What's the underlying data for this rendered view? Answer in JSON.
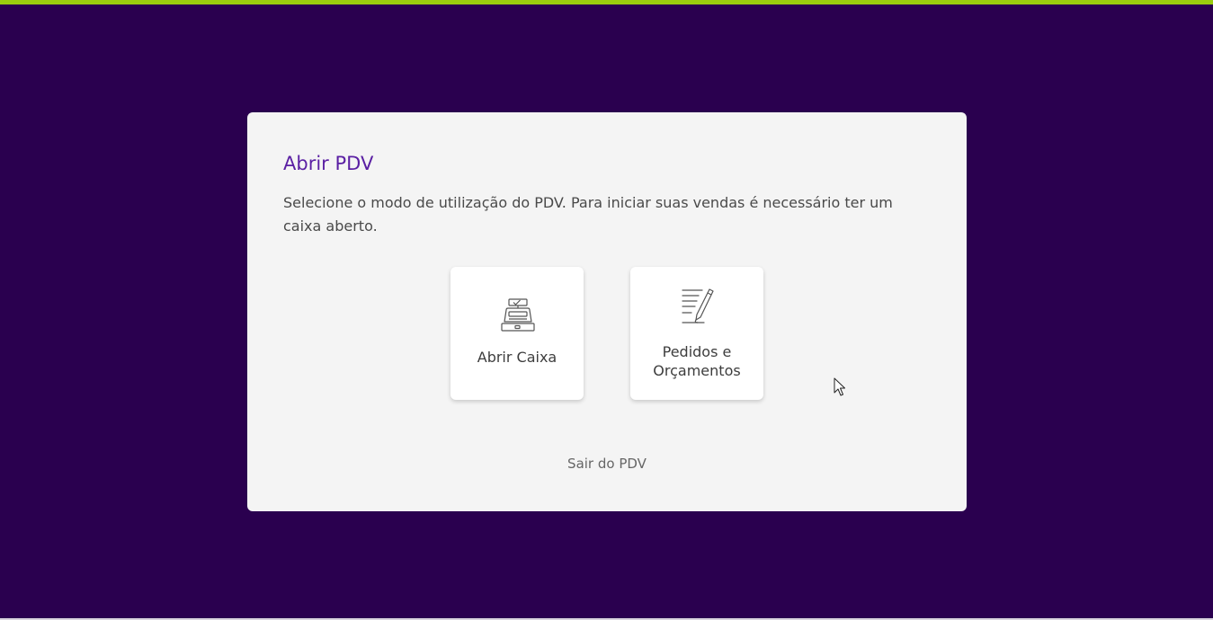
{
  "colors": {
    "background": "#2a004f",
    "accent_bar": "#9acd0e",
    "title": "#5a1fa3",
    "dialog_bg": "#f4f4f4"
  },
  "dialog": {
    "title": "Abrir PDV",
    "description": "Selecione o modo de utilização do PDV. Para iniciar suas vendas é necessário ter um caixa aberto.",
    "options": [
      {
        "label": "Abrir Caixa",
        "icon": "cash-register-icon"
      },
      {
        "label": "Pedidos e Orçamentos",
        "icon": "document-pen-icon"
      }
    ],
    "exit_label": "Sair do PDV"
  }
}
